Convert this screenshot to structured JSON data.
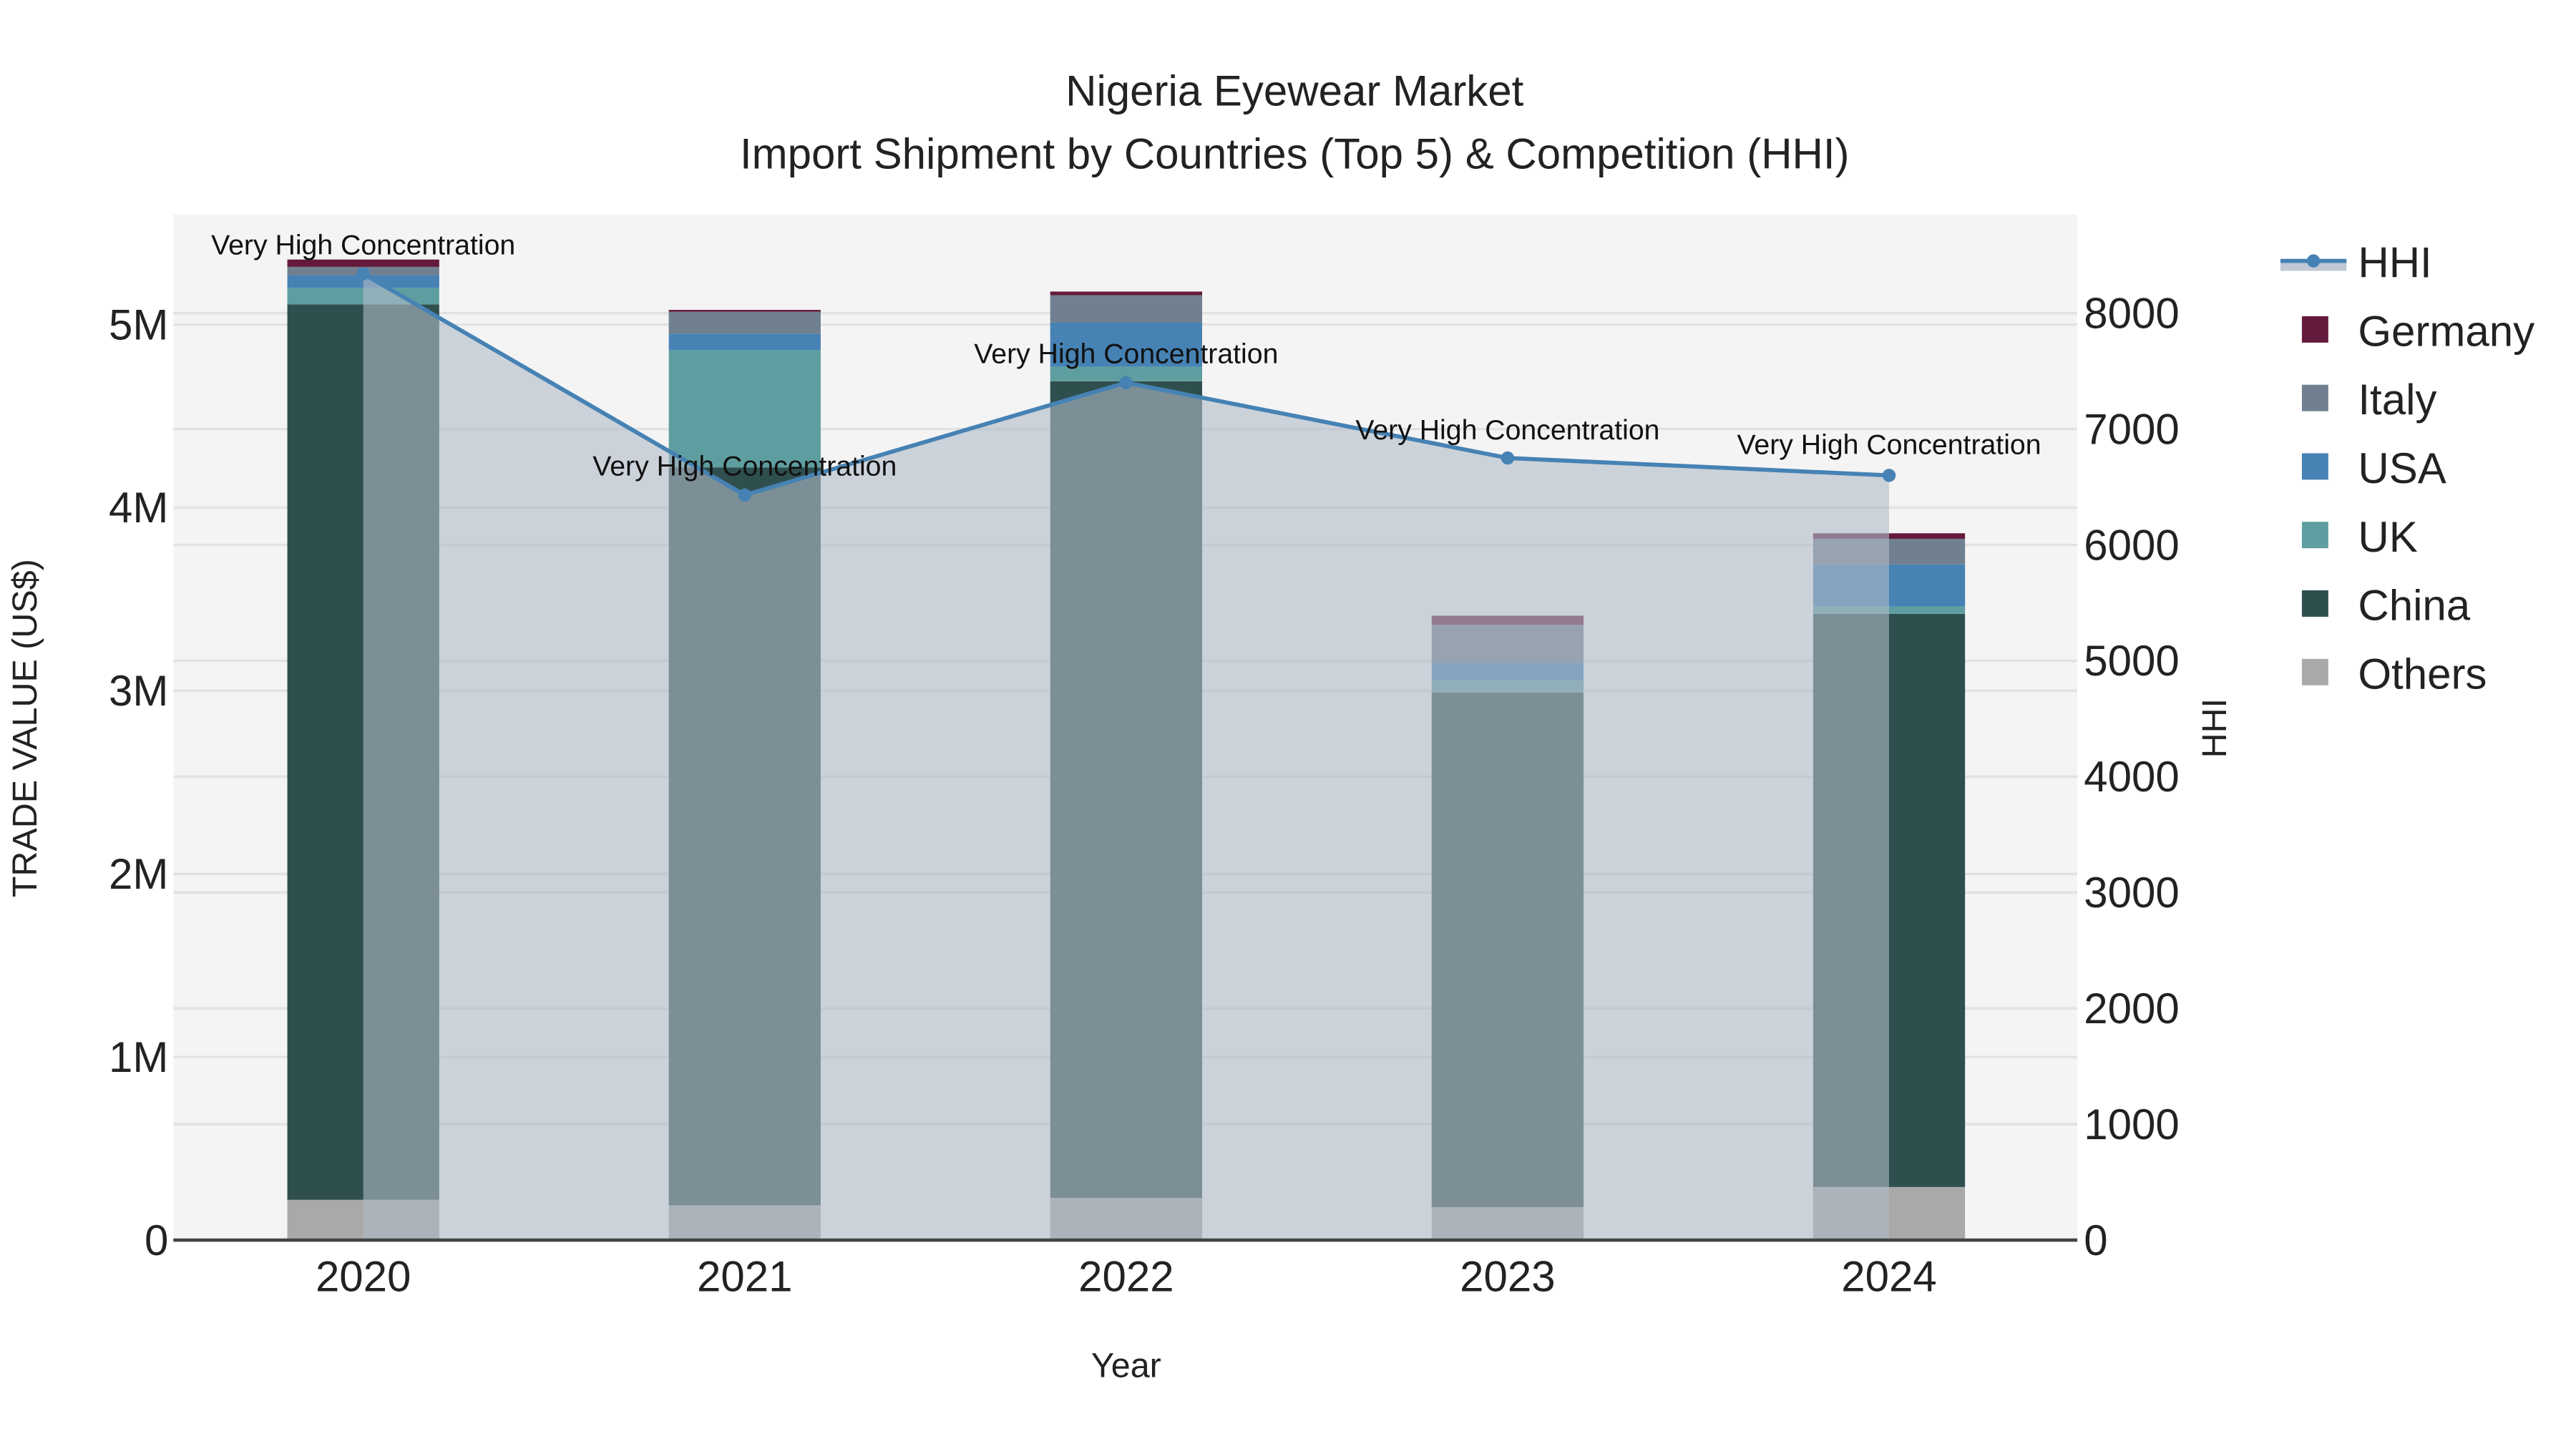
{
  "chart_data": {
    "type": "bar",
    "title": "Nigeria Eyewear Market",
    "subtitle": "Import Shipment by Countries (Top 5) & Competition (HHI)",
    "xlabel": "Year",
    "ylabel": "TRADE VALUE (US$)",
    "y2label": "HHI",
    "categories": [
      "2020",
      "2021",
      "2022",
      "2023",
      "2024"
    ],
    "ylim": [
      0,
      5600000
    ],
    "y2lim": [
      0,
      8850
    ],
    "yticks": [
      0,
      1000000,
      2000000,
      3000000,
      4000000,
      5000000
    ],
    "ytick_labels": [
      "0",
      "1M",
      "2M",
      "3M",
      "4M",
      "5M"
    ],
    "y2ticks": [
      0,
      1000,
      2000,
      3000,
      4000,
      5000,
      6000,
      7000,
      8000
    ],
    "y2tick_labels": [
      "0",
      "1000",
      "2000",
      "3000",
      "4000",
      "5000",
      "6000",
      "7000",
      "8000"
    ],
    "grid": true,
    "legend_position": "right",
    "series": [
      {
        "name": "Others",
        "color": "#a9a9a9",
        "values": [
          220000,
          190000,
          230000,
          180000,
          290000
        ]
      },
      {
        "name": "China",
        "color": "#2f4f4f",
        "values": [
          4890000,
          4030000,
          4460000,
          2810000,
          3130000
        ]
      },
      {
        "name": "UK",
        "color": "#5f9ea0",
        "values": [
          90000,
          640000,
          80000,
          70000,
          40000
        ]
      },
      {
        "name": "USA",
        "color": "#4682b4",
        "values": [
          70000,
          90000,
          240000,
          90000,
          230000
        ]
      },
      {
        "name": "Italy",
        "color": "#708090",
        "values": [
          45000,
          120000,
          150000,
          210000,
          140000
        ]
      },
      {
        "name": "Germany",
        "color": "#641a3c",
        "values": [
          40000,
          10000,
          20000,
          50000,
          30000
        ]
      }
    ],
    "line": {
      "name": "HHI",
      "color": "#4682b4",
      "values": [
        8340,
        6430,
        7400,
        6750,
        6600
      ],
      "annotations": [
        "Very High Concentration",
        "Very High Concentration",
        "Very High Concentration",
        "Very High Concentration",
        "Very High Concentration"
      ]
    },
    "legend_order": [
      "HHI",
      "Germany",
      "Italy",
      "USA",
      "UK",
      "China",
      "Others"
    ]
  }
}
